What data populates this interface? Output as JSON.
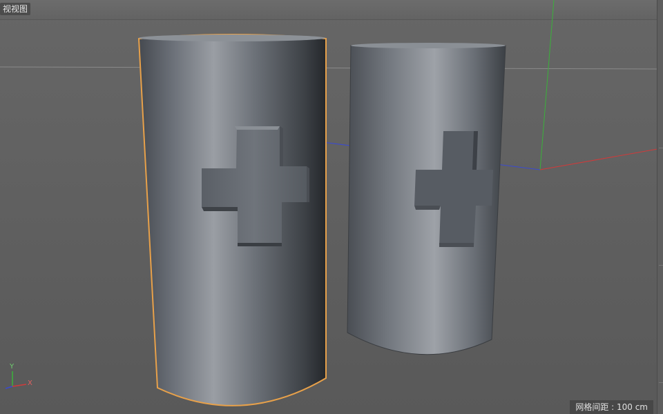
{
  "viewport": {
    "view_label": "视视图",
    "grid_info": "网格间距 : 100 cm"
  },
  "axis_gizmo": {
    "y_label": "Y",
    "x_label": "X"
  },
  "colors": {
    "background": "#626262",
    "selection_outline": "#e8a14a",
    "axis_x": "#d23a3a",
    "axis_y": "#3ab23a",
    "axis_z": "#3a4ad2",
    "object_gray": "#6f747b"
  },
  "scene_objects": [
    {
      "name": "Cylinder (selected)",
      "selected": true,
      "decoration": "embossed-cross"
    },
    {
      "name": "Cylinder",
      "selected": false,
      "decoration": "debossed-cross"
    }
  ]
}
